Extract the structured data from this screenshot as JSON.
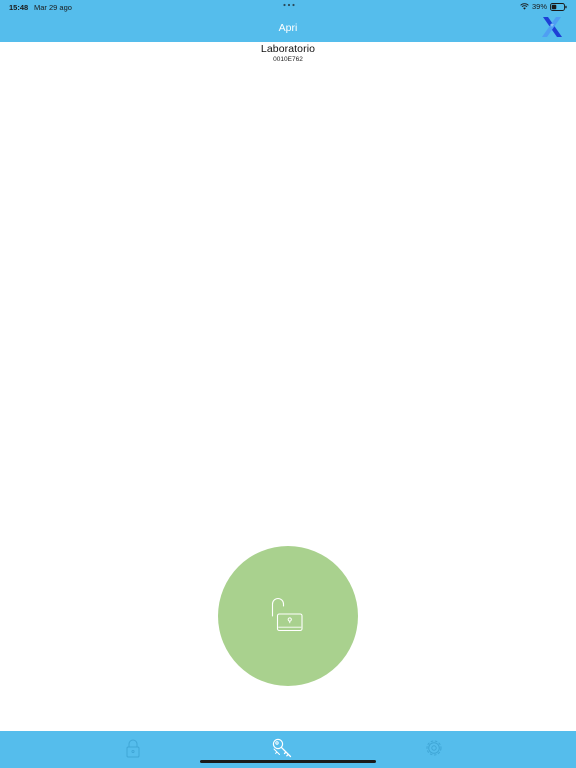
{
  "status_bar": {
    "time": "15:48",
    "date": "Mar 29 ago",
    "battery": "39%"
  },
  "nav": {
    "title": "Apri",
    "logo_icon": "brand-x-logo-icon"
  },
  "lock": {
    "name": "Laboratorio",
    "id": "0010E762"
  },
  "action": {
    "icon": "padlock-open-icon"
  },
  "tabbar": {
    "tabs": [
      {
        "icon": "padlock-icon"
      },
      {
        "icon": "keys-icon"
      },
      {
        "icon": "gear-icon"
      }
    ]
  },
  "colors": {
    "accent": "#55bdec",
    "open_button": "#a9d18e",
    "tab_icon": "#3fa6d6",
    "logo_blue": "#1d3fd6"
  }
}
